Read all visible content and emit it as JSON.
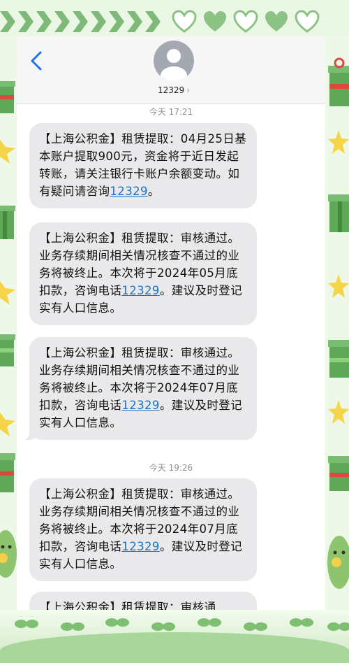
{
  "header": {
    "contact_name": "12329",
    "chevron": "›",
    "back_icon": "chevron-left-icon",
    "avatar_icon": "person-silhouette-icon"
  },
  "thread": {
    "timestamps": [
      "今天 17:21",
      "今天 19:26"
    ],
    "messages": [
      {
        "text_before": "【上海公积金】租赁提取：04月25日基本账户提取900元，资金将于近日发起转账，请关注银行卡账户余额变动。如有疑问请咨询",
        "link": "12329",
        "text_after": "。"
      },
      {
        "text_before": "【上海公积金】租赁提取：审核通过。业务存续期间相关情况核查不通过的业务将被终止。本次将于2024年05月底扣款，咨询电话",
        "link": "12329",
        "text_after": "。建议及时登记实有人口信息。"
      },
      {
        "text_before": "【上海公积金】租赁提取：审核通过。业务存续期间相关情况核查不通过的业务将被终止。本次将于2024年07月底扣款，咨询电话",
        "link": "12329",
        "text_after": "。建议及时登记实有人口信息。"
      },
      {
        "text_before": "【上海公积金】租赁提取：审核通过。业务存续期间相关情况核查不通过的业务将被终止。本次将于2024年07月底扣款，咨询电话",
        "link": "12329",
        "text_after": "。建议及时登记实有人口信息。"
      },
      {
        "text_before": "【上海公积金】租赁提取：审核通",
        "link": "",
        "text_after": ""
      }
    ]
  },
  "colors": {
    "bubble": "#e9e9eb",
    "link": "#1a73c7",
    "frame_green": "#7fb97a",
    "frame_bg": "#eaf7e4"
  }
}
